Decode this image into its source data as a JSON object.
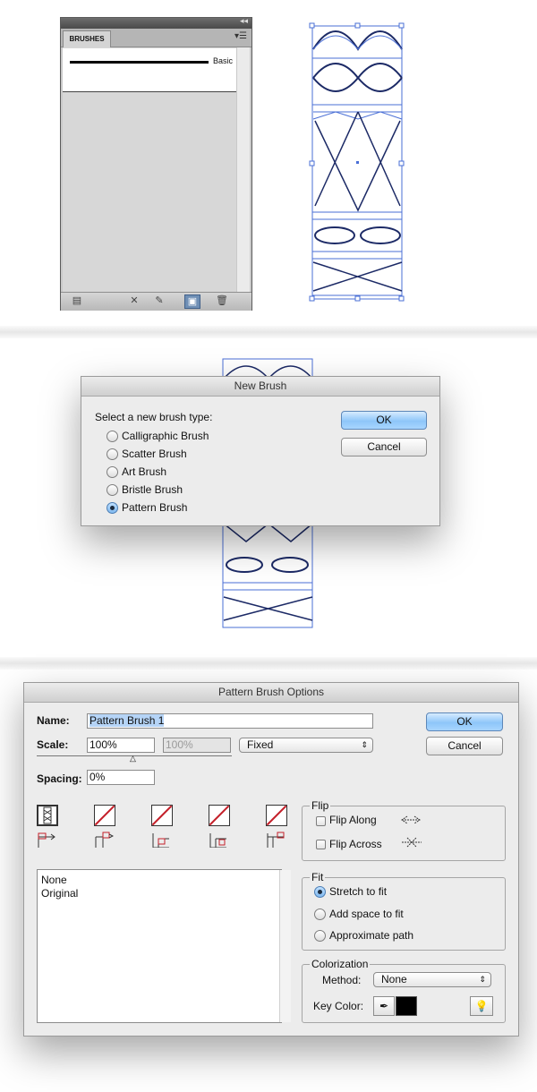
{
  "brushes_panel": {
    "tab": "BRUSHES",
    "basic_label": "Basic"
  },
  "new_brush": {
    "title": "New Brush",
    "prompt": "Select a new brush type:",
    "options": [
      "Calligraphic Brush",
      "Scatter Brush",
      "Art Brush",
      "Bristle Brush",
      "Pattern Brush"
    ],
    "selected": "Pattern Brush",
    "ok": "OK",
    "cancel": "Cancel"
  },
  "pattern_options": {
    "title": "Pattern Brush Options",
    "name_label": "Name:",
    "name_value": "Pattern Brush 1",
    "scale_label": "Scale:",
    "scale_value": "100%",
    "scale_value2": "100%",
    "scale_mode": "Fixed",
    "spacing_label": "Spacing:",
    "spacing_value": "0%",
    "ok": "OK",
    "cancel": "Cancel",
    "tile_list": [
      "None",
      "Original"
    ],
    "flip": {
      "title": "Flip",
      "along": "Flip Along",
      "across": "Flip Across"
    },
    "fit": {
      "title": "Fit",
      "options": [
        "Stretch to fit",
        "Add space to fit",
        "Approximate path"
      ],
      "selected": "Stretch to fit"
    },
    "colorization": {
      "title": "Colorization",
      "method_label": "Method:",
      "method_value": "None",
      "key_color_label": "Key Color:",
      "key_color": "#000000"
    }
  },
  "colors": {
    "selection_blue": "#4a6fd6",
    "ok_blue": "#8ec6f9",
    "slash_red": "#c4202a"
  }
}
